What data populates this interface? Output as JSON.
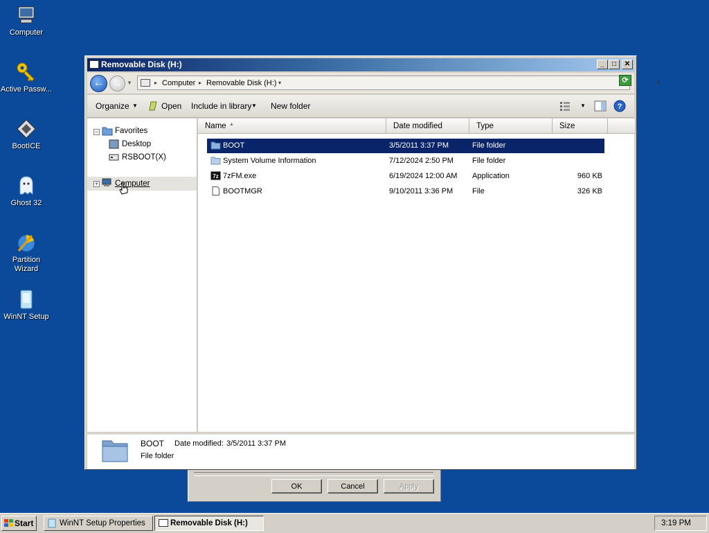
{
  "desktop": {
    "icons": [
      {
        "label": "Computer",
        "icon": "computer-icon"
      },
      {
        "label": "Active Passw...",
        "icon": "key-icon"
      },
      {
        "label": "BootICE",
        "icon": "bootice-icon"
      },
      {
        "label": "Ghost 32",
        "icon": "ghost-icon"
      },
      {
        "label": "Partition Wizard",
        "icon": "partition-wizard-icon"
      },
      {
        "label": "WinNT Setup",
        "icon": "winnt-setup-icon"
      }
    ]
  },
  "background_dialog": {
    "ok": "OK",
    "cancel": "Cancel",
    "apply": "Apply"
  },
  "window": {
    "title": "Removable Disk (H:)",
    "address": {
      "crumbs": [
        "Computer",
        "Removable Disk (H:)"
      ]
    },
    "commands": {
      "organize": "Organize",
      "open": "Open",
      "include_in_library": "Include in library",
      "new_folder": "New folder"
    },
    "nav": {
      "favorites": "Favorites",
      "desktop": "Desktop",
      "rsboot": "RSBOOT(X)",
      "computer": "Computer"
    },
    "columns": {
      "name": "Name",
      "date": "Date modified",
      "type": "Type",
      "size": "Size"
    },
    "files": [
      {
        "name": "BOOT",
        "date": "3/5/2011 3:37 PM",
        "type": "File folder",
        "size": "",
        "icon": "folder-icon"
      },
      {
        "name": "System Volume Information",
        "date": "7/12/2024 2:50 PM",
        "type": "File folder",
        "size": "",
        "icon": "folder-icon"
      },
      {
        "name": "7zFM.exe",
        "date": "6/19/2024 12:00 AM",
        "type": "Application",
        "size": "960 KB",
        "icon": "7zip-icon"
      },
      {
        "name": "BOOTMGR",
        "date": "9/10/2011 3:36 PM",
        "type": "File",
        "size": "326 KB",
        "icon": "file-icon"
      }
    ],
    "details": {
      "name": "BOOT",
      "date_label": "Date modified:",
      "date_value": "3/5/2011 3:37 PM",
      "type": "File folder"
    }
  },
  "taskbar": {
    "start": "Start",
    "tasks": [
      "WinNT Setup Properties",
      "Removable Disk (H:)"
    ],
    "clock": "3:19 PM"
  },
  "colors": {
    "desktop": "#0b4a9b",
    "selection": "#0a246a",
    "titlebar_start": "#0a246a"
  }
}
